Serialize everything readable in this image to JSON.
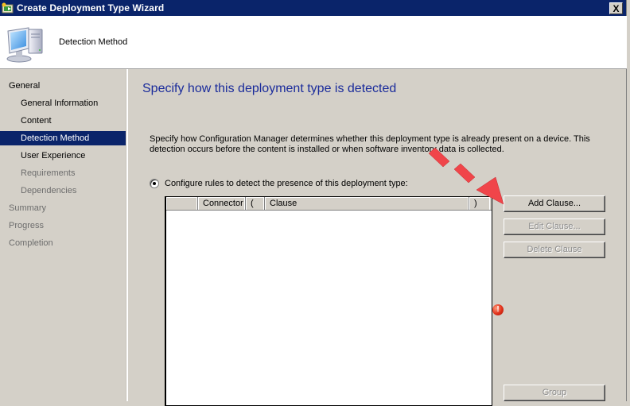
{
  "window": {
    "title": "Create Deployment Type Wizard",
    "close_label": "X"
  },
  "header": {
    "title": "Detection Method",
    "icon": "computer-icon"
  },
  "sidebar": {
    "items": [
      {
        "label": "General",
        "level": "top",
        "state": "normal"
      },
      {
        "label": "General Information",
        "level": "sub",
        "state": "normal"
      },
      {
        "label": "Content",
        "level": "sub",
        "state": "normal"
      },
      {
        "label": "Detection Method",
        "level": "sub",
        "state": "active"
      },
      {
        "label": "User Experience",
        "level": "sub",
        "state": "normal"
      },
      {
        "label": "Requirements",
        "level": "sub",
        "state": "dim"
      },
      {
        "label": "Dependencies",
        "level": "sub",
        "state": "dim"
      },
      {
        "label": "Summary",
        "level": "top",
        "state": "dim"
      },
      {
        "label": "Progress",
        "level": "top",
        "state": "dim"
      },
      {
        "label": "Completion",
        "level": "top",
        "state": "dim"
      }
    ]
  },
  "main": {
    "heading": "Specify how this deployment type is detected",
    "description_line1": "Specify how Configuration Manager determines whether this deployment type is already present on a device. This",
    "description_line2": "detection occurs before the content is installed or when software inventory data is collected.",
    "radio_label": "Configure rules to detect the presence of this deployment type:",
    "radio_selected": true,
    "grid": {
      "columns": [
        "",
        "Connector",
        "(",
        "Clause",
        ")"
      ],
      "rows": []
    },
    "buttons": {
      "add_clause": "Add Clause...",
      "edit_clause": "Edit Clause...",
      "delete_clause": "Delete Clause",
      "group": "Group"
    },
    "validation_icon": "error-icon"
  },
  "colors": {
    "titlebar": "#0a246a",
    "selection": "#0a246a",
    "heading": "#1a2b9b",
    "annotation_arrow": "#f0454a",
    "dialog_bg": "#d4d0c8"
  }
}
